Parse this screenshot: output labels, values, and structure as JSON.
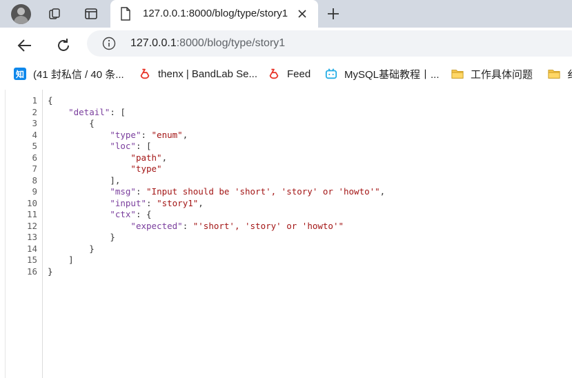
{
  "browser": {
    "tab": {
      "title": "127.0.0.1:8000/blog/type/story1"
    },
    "address": {
      "host": "127.0.0.1",
      "rest": ":8000/blog/type/story1"
    },
    "bookmarks": [
      {
        "label": "(41 封私信 / 40 条...",
        "icon": "zhihu-icon"
      },
      {
        "label": "thenx | BandLab Se...",
        "icon": "bandlab-icon"
      },
      {
        "label": "Feed",
        "icon": "bandlab-icon"
      },
      {
        "label": "MySQL基础教程丨...",
        "icon": "bilibili-icon"
      },
      {
        "label": "工作具体问题",
        "icon": "folder-icon"
      },
      {
        "label": "纟",
        "icon": "folder-icon"
      }
    ]
  },
  "json_view": {
    "line_numbers": [
      "1",
      "2",
      "3",
      "4",
      "5",
      "6",
      "7",
      "8",
      "9",
      "10",
      "11",
      "12",
      "13",
      "14",
      "15",
      "16"
    ],
    "keys": {
      "detail": "\"detail\"",
      "type": "\"type\"",
      "loc": "\"loc\"",
      "msg": "\"msg\"",
      "input": "\"input\"",
      "ctx": "\"ctx\"",
      "expected": "\"expected\""
    },
    "values": {
      "type": "\"enum\"",
      "loc_0": "\"path\"",
      "loc_1": "\"type\"",
      "msg": "\"Input should be 'short', 'story' or 'howto'\"",
      "input": "\"story1\"",
      "expected": "\"'short', 'story' or 'howto'\""
    }
  }
}
